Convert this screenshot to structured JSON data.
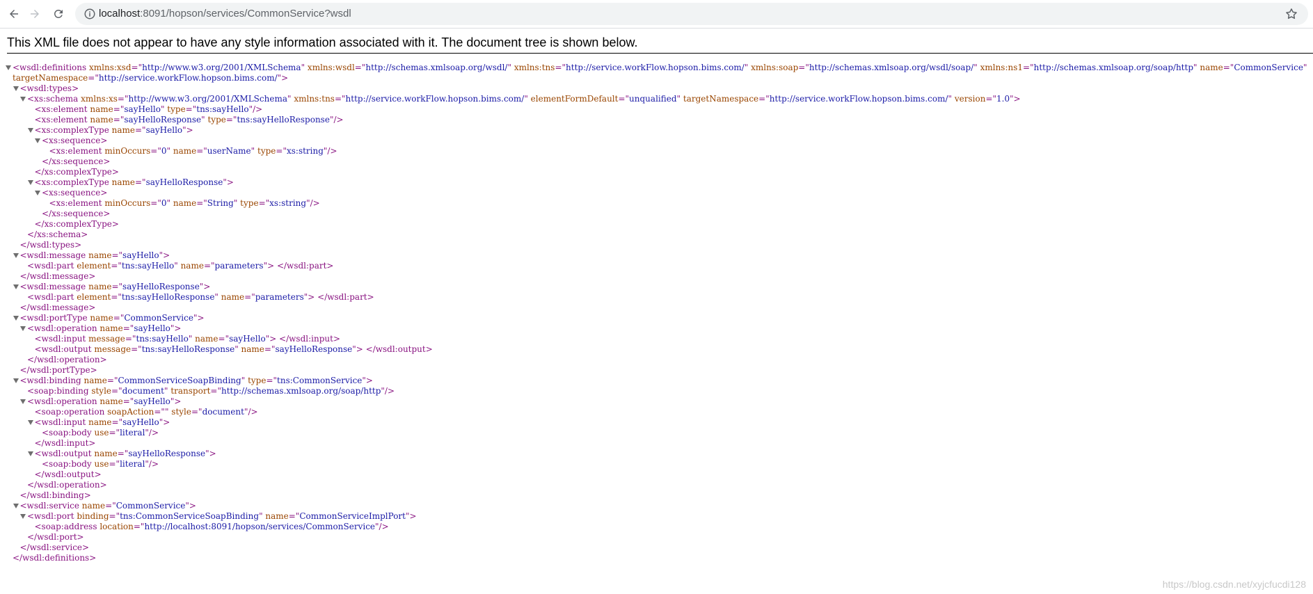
{
  "browser": {
    "url_host": "localhost",
    "url_rest": ":8091/hopson/services/CommonService?wsdl"
  },
  "banner": "This XML file does not appear to have any style information associated with it. The document tree is shown below.",
  "watermark": "https://blog.csdn.net/xyjcfucdi128",
  "xml_lines": [
    {
      "indent": 0,
      "arrow": true,
      "parts": [
        [
          "t",
          "<wsdl:definitions"
        ],
        [
          "a",
          " xmlns:xsd"
        ],
        [
          "t",
          "=\""
        ],
        [
          "v",
          "http://www.w3.org/2001/XMLSchema"
        ],
        [
          "t",
          "\""
        ],
        [
          "a",
          " xmlns:wsdl"
        ],
        [
          "t",
          "=\""
        ],
        [
          "v",
          "http://schemas.xmlsoap.org/wsdl/"
        ],
        [
          "t",
          "\""
        ],
        [
          "a",
          " xmlns:tns"
        ],
        [
          "t",
          "=\""
        ],
        [
          "v",
          "http://service.workFlow.hopson.bims.com/"
        ],
        [
          "t",
          "\""
        ],
        [
          "a",
          " xmlns:soap"
        ],
        [
          "t",
          "=\""
        ],
        [
          "v",
          "http://schemas.xmlsoap.org/wsdl/soap/"
        ],
        [
          "t",
          "\""
        ],
        [
          "a",
          " xmlns:ns1"
        ],
        [
          "t",
          "=\""
        ],
        [
          "v",
          "http://schemas.xmlsoap.org/soap/http"
        ],
        [
          "t",
          "\""
        ],
        [
          "a",
          " name"
        ],
        [
          "t",
          "=\""
        ],
        [
          "v",
          "CommonService"
        ],
        [
          "t",
          "\""
        ]
      ]
    },
    {
      "indent": 0,
      "arrow": false,
      "parts": [
        [
          "a",
          "targetNamespace"
        ],
        [
          "t",
          "=\""
        ],
        [
          "v",
          "http://service.workFlow.hopson.bims.com/"
        ],
        [
          "t",
          "\">"
        ]
      ]
    },
    {
      "indent": 1,
      "arrow": true,
      "parts": [
        [
          "t",
          "<wsdl:types>"
        ]
      ]
    },
    {
      "indent": 2,
      "arrow": true,
      "parts": [
        [
          "t",
          "<xs:schema"
        ],
        [
          "a",
          " xmlns:xs"
        ],
        [
          "t",
          "=\""
        ],
        [
          "v",
          "http://www.w3.org/2001/XMLSchema"
        ],
        [
          "t",
          "\""
        ],
        [
          "a",
          " xmlns:tns"
        ],
        [
          "t",
          "=\""
        ],
        [
          "v",
          "http://service.workFlow.hopson.bims.com/"
        ],
        [
          "t",
          "\""
        ],
        [
          "a",
          " elementFormDefault"
        ],
        [
          "t",
          "=\""
        ],
        [
          "v",
          "unqualified"
        ],
        [
          "t",
          "\""
        ],
        [
          "a",
          " targetNamespace"
        ],
        [
          "t",
          "=\""
        ],
        [
          "v",
          "http://service.workFlow.hopson.bims.com/"
        ],
        [
          "t",
          "\""
        ],
        [
          "a",
          " version"
        ],
        [
          "t",
          "=\""
        ],
        [
          "v",
          "1.0"
        ],
        [
          "t",
          "\">"
        ]
      ]
    },
    {
      "indent": 3,
      "arrow": false,
      "parts": [
        [
          "t",
          "<xs:element"
        ],
        [
          "a",
          " name"
        ],
        [
          "t",
          "=\""
        ],
        [
          "v",
          "sayHello"
        ],
        [
          "t",
          "\""
        ],
        [
          "a",
          " type"
        ],
        [
          "t",
          "=\""
        ],
        [
          "v",
          "tns:sayHello"
        ],
        [
          "t",
          "\"/>"
        ]
      ]
    },
    {
      "indent": 3,
      "arrow": false,
      "parts": [
        [
          "t",
          "<xs:element"
        ],
        [
          "a",
          " name"
        ],
        [
          "t",
          "=\""
        ],
        [
          "v",
          "sayHelloResponse"
        ],
        [
          "t",
          "\""
        ],
        [
          "a",
          " type"
        ],
        [
          "t",
          "=\""
        ],
        [
          "v",
          "tns:sayHelloResponse"
        ],
        [
          "t",
          "\"/>"
        ]
      ]
    },
    {
      "indent": 3,
      "arrow": true,
      "parts": [
        [
          "t",
          "<xs:complexType"
        ],
        [
          "a",
          " name"
        ],
        [
          "t",
          "=\""
        ],
        [
          "v",
          "sayHello"
        ],
        [
          "t",
          "\">"
        ]
      ]
    },
    {
      "indent": 4,
      "arrow": true,
      "parts": [
        [
          "t",
          "<xs:sequence>"
        ]
      ]
    },
    {
      "indent": 5,
      "arrow": false,
      "parts": [
        [
          "t",
          "<xs:element"
        ],
        [
          "a",
          " minOccurs"
        ],
        [
          "t",
          "=\""
        ],
        [
          "v",
          "0"
        ],
        [
          "t",
          "\""
        ],
        [
          "a",
          " name"
        ],
        [
          "t",
          "=\""
        ],
        [
          "v",
          "userName"
        ],
        [
          "t",
          "\""
        ],
        [
          "a",
          " type"
        ],
        [
          "t",
          "=\""
        ],
        [
          "v",
          "xs:string"
        ],
        [
          "t",
          "\"/>"
        ]
      ]
    },
    {
      "indent": 4,
      "arrow": false,
      "parts": [
        [
          "t",
          "</xs:sequence>"
        ]
      ]
    },
    {
      "indent": 3,
      "arrow": false,
      "parts": [
        [
          "t",
          "</xs:complexType>"
        ]
      ]
    },
    {
      "indent": 3,
      "arrow": true,
      "parts": [
        [
          "t",
          "<xs:complexType"
        ],
        [
          "a",
          " name"
        ],
        [
          "t",
          "=\""
        ],
        [
          "v",
          "sayHelloResponse"
        ],
        [
          "t",
          "\">"
        ]
      ]
    },
    {
      "indent": 4,
      "arrow": true,
      "parts": [
        [
          "t",
          "<xs:sequence>"
        ]
      ]
    },
    {
      "indent": 5,
      "arrow": false,
      "parts": [
        [
          "t",
          "<xs:element"
        ],
        [
          "a",
          " minOccurs"
        ],
        [
          "t",
          "=\""
        ],
        [
          "v",
          "0"
        ],
        [
          "t",
          "\""
        ],
        [
          "a",
          " name"
        ],
        [
          "t",
          "=\""
        ],
        [
          "v",
          "String"
        ],
        [
          "t",
          "\""
        ],
        [
          "a",
          " type"
        ],
        [
          "t",
          "=\""
        ],
        [
          "v",
          "xs:string"
        ],
        [
          "t",
          "\"/>"
        ]
      ]
    },
    {
      "indent": 4,
      "arrow": false,
      "parts": [
        [
          "t",
          "</xs:sequence>"
        ]
      ]
    },
    {
      "indent": 3,
      "arrow": false,
      "parts": [
        [
          "t",
          "</xs:complexType>"
        ]
      ]
    },
    {
      "indent": 2,
      "arrow": false,
      "parts": [
        [
          "t",
          "</xs:schema>"
        ]
      ]
    },
    {
      "indent": 1,
      "arrow": false,
      "parts": [
        [
          "t",
          "</wsdl:types>"
        ]
      ]
    },
    {
      "indent": 1,
      "arrow": true,
      "parts": [
        [
          "t",
          "<wsdl:message"
        ],
        [
          "a",
          " name"
        ],
        [
          "t",
          "=\""
        ],
        [
          "v",
          "sayHello"
        ],
        [
          "t",
          "\">"
        ]
      ]
    },
    {
      "indent": 2,
      "arrow": false,
      "parts": [
        [
          "t",
          "<wsdl:part"
        ],
        [
          "a",
          " element"
        ],
        [
          "t",
          "=\""
        ],
        [
          "v",
          "tns:sayHello"
        ],
        [
          "t",
          "\""
        ],
        [
          "a",
          " name"
        ],
        [
          "t",
          "=\""
        ],
        [
          "v",
          "parameters"
        ],
        [
          "t",
          "\"> </wsdl:part>"
        ]
      ]
    },
    {
      "indent": 1,
      "arrow": false,
      "parts": [
        [
          "t",
          "</wsdl:message>"
        ]
      ]
    },
    {
      "indent": 1,
      "arrow": true,
      "parts": [
        [
          "t",
          "<wsdl:message"
        ],
        [
          "a",
          " name"
        ],
        [
          "t",
          "=\""
        ],
        [
          "v",
          "sayHelloResponse"
        ],
        [
          "t",
          "\">"
        ]
      ]
    },
    {
      "indent": 2,
      "arrow": false,
      "parts": [
        [
          "t",
          "<wsdl:part"
        ],
        [
          "a",
          " element"
        ],
        [
          "t",
          "=\""
        ],
        [
          "v",
          "tns:sayHelloResponse"
        ],
        [
          "t",
          "\""
        ],
        [
          "a",
          " name"
        ],
        [
          "t",
          "=\""
        ],
        [
          "v",
          "parameters"
        ],
        [
          "t",
          "\"> </wsdl:part>"
        ]
      ]
    },
    {
      "indent": 1,
      "arrow": false,
      "parts": [
        [
          "t",
          "</wsdl:message>"
        ]
      ]
    },
    {
      "indent": 1,
      "arrow": true,
      "parts": [
        [
          "t",
          "<wsdl:portType"
        ],
        [
          "a",
          " name"
        ],
        [
          "t",
          "=\""
        ],
        [
          "v",
          "CommonService"
        ],
        [
          "t",
          "\">"
        ]
      ]
    },
    {
      "indent": 2,
      "arrow": true,
      "parts": [
        [
          "t",
          "<wsdl:operation"
        ],
        [
          "a",
          " name"
        ],
        [
          "t",
          "=\""
        ],
        [
          "v",
          "sayHello"
        ],
        [
          "t",
          "\">"
        ]
      ]
    },
    {
      "indent": 3,
      "arrow": false,
      "parts": [
        [
          "t",
          "<wsdl:input"
        ],
        [
          "a",
          " message"
        ],
        [
          "t",
          "=\""
        ],
        [
          "v",
          "tns:sayHello"
        ],
        [
          "t",
          "\""
        ],
        [
          "a",
          " name"
        ],
        [
          "t",
          "=\""
        ],
        [
          "v",
          "sayHello"
        ],
        [
          "t",
          "\"> </wsdl:input>"
        ]
      ]
    },
    {
      "indent": 3,
      "arrow": false,
      "parts": [
        [
          "t",
          "<wsdl:output"
        ],
        [
          "a",
          " message"
        ],
        [
          "t",
          "=\""
        ],
        [
          "v",
          "tns:sayHelloResponse"
        ],
        [
          "t",
          "\""
        ],
        [
          "a",
          " name"
        ],
        [
          "t",
          "=\""
        ],
        [
          "v",
          "sayHelloResponse"
        ],
        [
          "t",
          "\"> </wsdl:output>"
        ]
      ]
    },
    {
      "indent": 2,
      "arrow": false,
      "parts": [
        [
          "t",
          "</wsdl:operation>"
        ]
      ]
    },
    {
      "indent": 1,
      "arrow": false,
      "parts": [
        [
          "t",
          "</wsdl:portType>"
        ]
      ]
    },
    {
      "indent": 1,
      "arrow": true,
      "parts": [
        [
          "t",
          "<wsdl:binding"
        ],
        [
          "a",
          " name"
        ],
        [
          "t",
          "=\""
        ],
        [
          "v",
          "CommonServiceSoapBinding"
        ],
        [
          "t",
          "\""
        ],
        [
          "a",
          " type"
        ],
        [
          "t",
          "=\""
        ],
        [
          "v",
          "tns:CommonService"
        ],
        [
          "t",
          "\">"
        ]
      ]
    },
    {
      "indent": 2,
      "arrow": false,
      "parts": [
        [
          "t",
          "<soap:binding"
        ],
        [
          "a",
          " style"
        ],
        [
          "t",
          "=\""
        ],
        [
          "v",
          "document"
        ],
        [
          "t",
          "\""
        ],
        [
          "a",
          " transport"
        ],
        [
          "t",
          "=\""
        ],
        [
          "v",
          "http://schemas.xmlsoap.org/soap/http"
        ],
        [
          "t",
          "\"/>"
        ]
      ]
    },
    {
      "indent": 2,
      "arrow": true,
      "parts": [
        [
          "t",
          "<wsdl:operation"
        ],
        [
          "a",
          " name"
        ],
        [
          "t",
          "=\""
        ],
        [
          "v",
          "sayHello"
        ],
        [
          "t",
          "\">"
        ]
      ]
    },
    {
      "indent": 3,
      "arrow": false,
      "parts": [
        [
          "t",
          "<soap:operation"
        ],
        [
          "a",
          " soapAction"
        ],
        [
          "t",
          "=\"\""
        ],
        [
          "a",
          " style"
        ],
        [
          "t",
          "=\""
        ],
        [
          "v",
          "document"
        ],
        [
          "t",
          "\"/>"
        ]
      ]
    },
    {
      "indent": 3,
      "arrow": true,
      "parts": [
        [
          "t",
          "<wsdl:input"
        ],
        [
          "a",
          " name"
        ],
        [
          "t",
          "=\""
        ],
        [
          "v",
          "sayHello"
        ],
        [
          "t",
          "\">"
        ]
      ]
    },
    {
      "indent": 4,
      "arrow": false,
      "parts": [
        [
          "t",
          "<soap:body"
        ],
        [
          "a",
          " use"
        ],
        [
          "t",
          "=\""
        ],
        [
          "v",
          "literal"
        ],
        [
          "t",
          "\"/>"
        ]
      ]
    },
    {
      "indent": 3,
      "arrow": false,
      "parts": [
        [
          "t",
          "</wsdl:input>"
        ]
      ]
    },
    {
      "indent": 3,
      "arrow": true,
      "parts": [
        [
          "t",
          "<wsdl:output"
        ],
        [
          "a",
          " name"
        ],
        [
          "t",
          "=\""
        ],
        [
          "v",
          "sayHelloResponse"
        ],
        [
          "t",
          "\">"
        ]
      ]
    },
    {
      "indent": 4,
      "arrow": false,
      "parts": [
        [
          "t",
          "<soap:body"
        ],
        [
          "a",
          " use"
        ],
        [
          "t",
          "=\""
        ],
        [
          "v",
          "literal"
        ],
        [
          "t",
          "\"/>"
        ]
      ]
    },
    {
      "indent": 3,
      "arrow": false,
      "parts": [
        [
          "t",
          "</wsdl:output>"
        ]
      ]
    },
    {
      "indent": 2,
      "arrow": false,
      "parts": [
        [
          "t",
          "</wsdl:operation>"
        ]
      ]
    },
    {
      "indent": 1,
      "arrow": false,
      "parts": [
        [
          "t",
          "</wsdl:binding>"
        ]
      ]
    },
    {
      "indent": 1,
      "arrow": true,
      "parts": [
        [
          "t",
          "<wsdl:service"
        ],
        [
          "a",
          " name"
        ],
        [
          "t",
          "=\""
        ],
        [
          "v",
          "CommonService"
        ],
        [
          "t",
          "\">"
        ]
      ]
    },
    {
      "indent": 2,
      "arrow": true,
      "parts": [
        [
          "t",
          "<wsdl:port"
        ],
        [
          "a",
          " binding"
        ],
        [
          "t",
          "=\""
        ],
        [
          "v",
          "tns:CommonServiceSoapBinding"
        ],
        [
          "t",
          "\""
        ],
        [
          "a",
          " name"
        ],
        [
          "t",
          "=\""
        ],
        [
          "v",
          "CommonServiceImplPort"
        ],
        [
          "t",
          "\">"
        ]
      ]
    },
    {
      "indent": 3,
      "arrow": false,
      "parts": [
        [
          "t",
          "<soap:address"
        ],
        [
          "a",
          " location"
        ],
        [
          "t",
          "=\""
        ],
        [
          "v",
          "http://localhost:8091/hopson/services/CommonService"
        ],
        [
          "t",
          "\"/>"
        ]
      ]
    },
    {
      "indent": 2,
      "arrow": false,
      "parts": [
        [
          "t",
          "</wsdl:port>"
        ]
      ]
    },
    {
      "indent": 1,
      "arrow": false,
      "parts": [
        [
          "t",
          "</wsdl:service>"
        ]
      ]
    },
    {
      "indent": 0,
      "arrow": false,
      "parts": [
        [
          "t",
          "</wsdl:definitions>"
        ]
      ]
    }
  ]
}
